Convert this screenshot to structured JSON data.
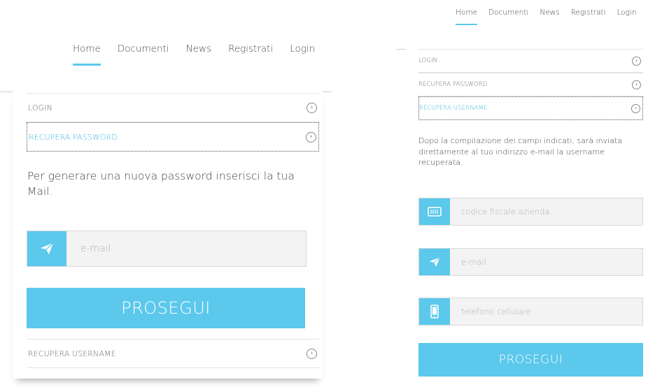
{
  "nav": {
    "items": [
      "Home",
      "Documenti",
      "News",
      "Registrati",
      "Login"
    ],
    "active": "Home"
  },
  "left_screen": {
    "menu": {
      "login": "LOGIN",
      "recupera_password": "RECUPERA PASSWORD",
      "recupera_username": "RECUPERA USERNAME"
    },
    "active_item": "RECUPERA PASSWORD",
    "description": "Per generare una nuova password inserisci la tua Mail.",
    "email_placeholder": "e-mail",
    "email_icon": "paper-plane-icon",
    "submit_label": "PROSEGUI"
  },
  "right_screen": {
    "menu": {
      "login": "LOGIN",
      "recupera_password": "RECUPERA PASSWORD",
      "recupera_username": "RECUPERA USERNAME"
    },
    "active_item": "RECUPERA USERNAME",
    "description": "Dopo la compilazione dei campi indicati, sarà inviata direttamente al tuo indirizzo e-mail la username recuperata.",
    "fields": [
      {
        "placeholder": "codice fiscale azienda",
        "icon": "id-card-icon"
      },
      {
        "placeholder": "e-mail",
        "icon": "paper-plane-icon"
      },
      {
        "placeholder": "telefono cellulare",
        "icon": "smartphone-icon"
      }
    ],
    "submit_label": "PROSEGUI"
  },
  "colors": {
    "accent": "#5bc8ec",
    "active_text": "#3fb6dd",
    "field_bg": "#f3f3f3"
  },
  "chevron_glyph": "›"
}
